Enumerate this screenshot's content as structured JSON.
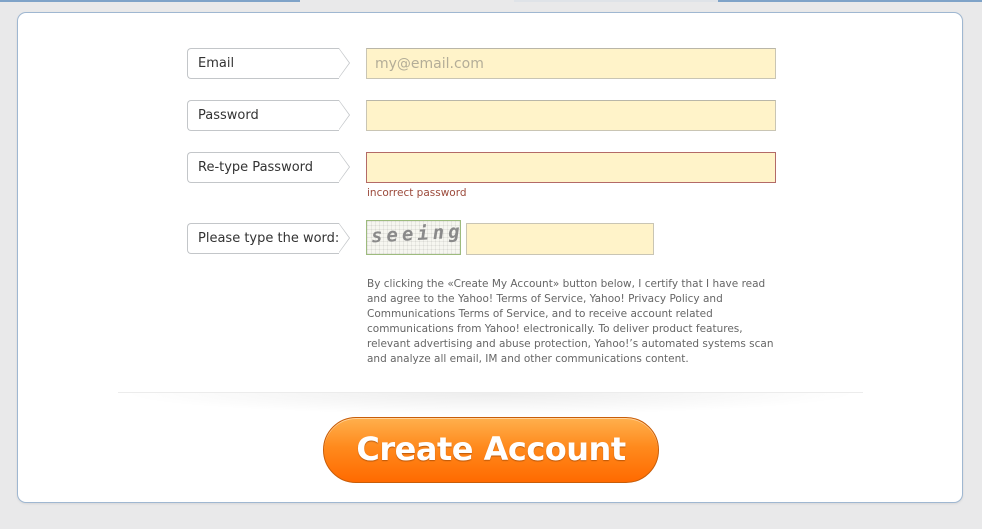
{
  "form": {
    "email": {
      "label": "Email",
      "placeholder": "my@email.com",
      "value": ""
    },
    "password": {
      "label": "Password",
      "value": ""
    },
    "retype_password": {
      "label": "Re-type Password",
      "value": "",
      "error": "incorrect password"
    },
    "captcha": {
      "label": "Please type the word:",
      "image_word": "seeing",
      "value": ""
    }
  },
  "terms_text": "By clicking the «Create My Account» button below, I certify that I have read and agree to the Yahoo! Terms of Service, Yahoo! Privacy Policy and Communications Terms of Service, and to receive account related communications from Yahoo! electronically. To deliver product features, relevant advertising and abuse protection, Yahoo!’s automated systems scan and analyze all email, IM and other communications content.",
  "submit_label": "Create Account",
  "colors": {
    "field_bg": "#fff3c9",
    "error_border": "#b36a67",
    "error_text": "#9c4b3c",
    "button_orange": "#ff7a10",
    "card_border": "#9fb7d1"
  }
}
